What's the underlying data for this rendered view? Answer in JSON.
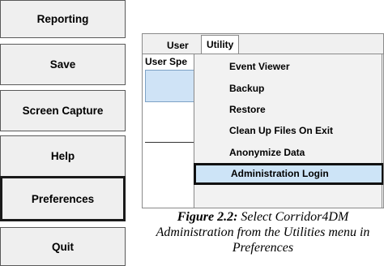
{
  "sidebar": {
    "buttons": [
      {
        "label": "Reporting"
      },
      {
        "label": "Save"
      },
      {
        "label": "Screen Capture"
      },
      {
        "label": "Help"
      },
      {
        "label": "Preferences"
      },
      {
        "label": "Quit"
      }
    ]
  },
  "panel": {
    "tabs": [
      {
        "label": "User"
      },
      {
        "label": "Utility"
      }
    ],
    "user_spec_label": "User Spe"
  },
  "menu": {
    "items": [
      {
        "label": "Event Viewer"
      },
      {
        "label": "Backup"
      },
      {
        "label": "Restore"
      },
      {
        "label": "Clean Up Files On Exit"
      },
      {
        "label": "Anonymize Data"
      },
      {
        "label": "Administration Login"
      }
    ],
    "selected_item": "Administration Login"
  },
  "caption": {
    "figure_label": "Figure 2.2:",
    "text": " Select Corridor4DM Administration from the Utilities menu in Preferences"
  },
  "colors": {
    "button_face": "#efefef",
    "menu_highlight": "#cde4f7",
    "list_blue": "#cfe3f6"
  }
}
